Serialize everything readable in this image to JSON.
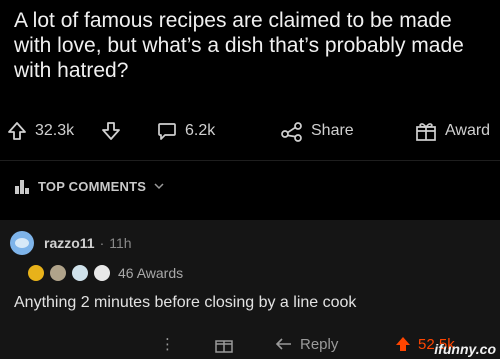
{
  "post": {
    "title": "A lot of famous recipes are claimed to be made with love, but what’s a dish that’s probably made with hatred?",
    "upvotes": "32.3k",
    "comments": "6.2k",
    "share_label": "Share",
    "award_label": "Award"
  },
  "sort": {
    "label": "TOP COMMENTS"
  },
  "comment": {
    "username": "razzo11",
    "separator": "·",
    "age": "11h",
    "awards_label": "46 Awards",
    "body": "Anything 2 minutes before closing by a line cook",
    "more_label": "⋮",
    "reply_label": "Reply",
    "votes": "52.5k"
  },
  "watermark": "ifunny.co",
  "colors": {
    "background": "#000000",
    "comment_bg": "#151515",
    "accent": "#ff4500",
    "text": "#d7dadc"
  }
}
